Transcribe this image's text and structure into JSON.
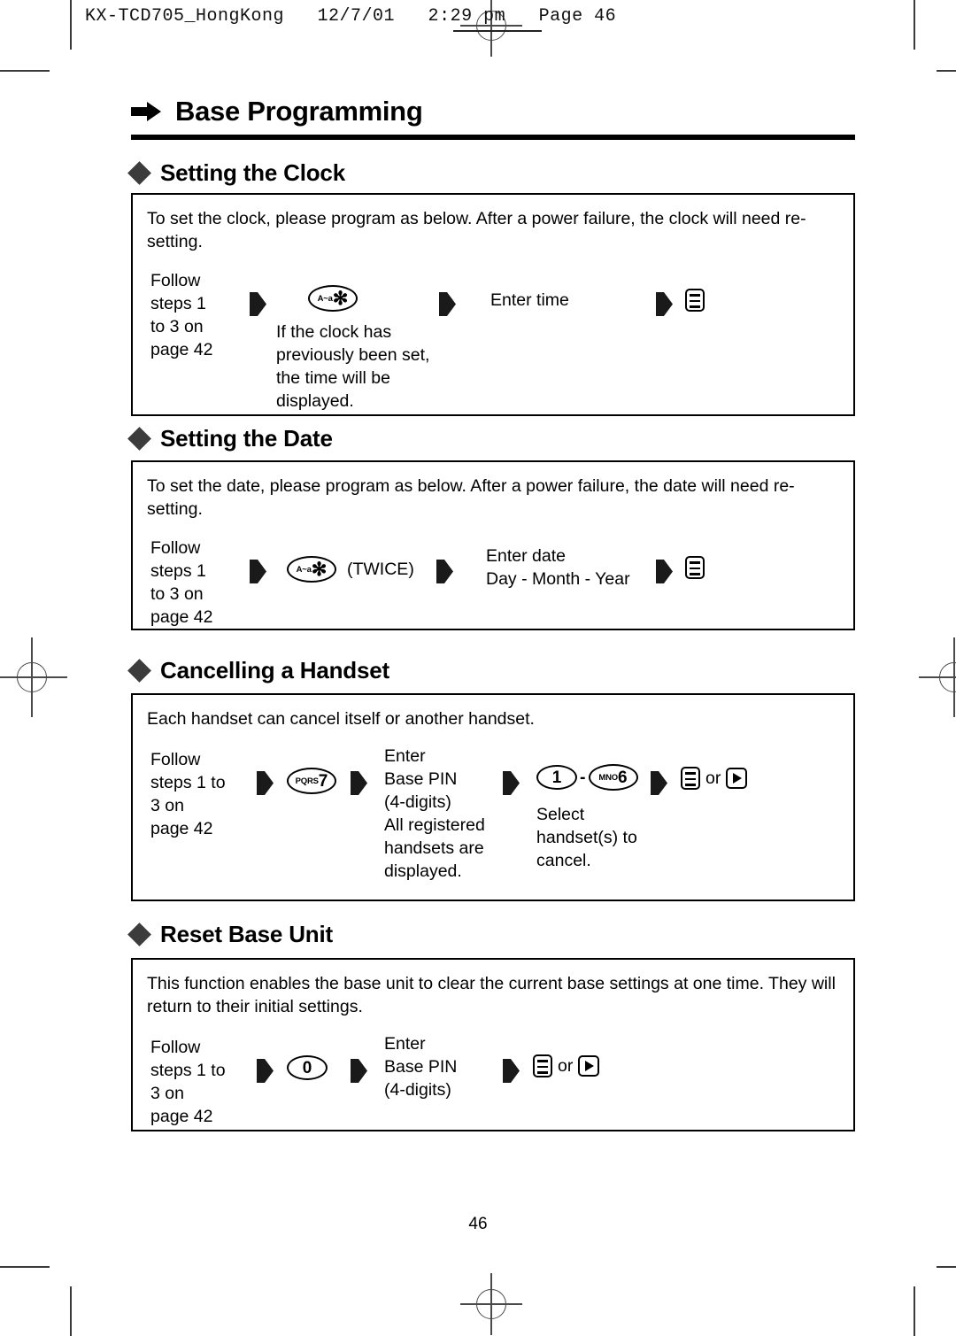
{
  "print_header": {
    "text": "KX-TCD705_HongKong   12/7/01   2:29 pm   Page 46"
  },
  "chapter": {
    "icon": "right-arrow-icon",
    "title": "Base Programming"
  },
  "sections": [
    {
      "id": "setting-the-clock",
      "bullet": "diamond-bullet-icon",
      "title": "Setting the Clock",
      "intro": "To set the clock, please program as below. After a power failure, the clock will need re-setting.",
      "steps": [
        {
          "label": "Follow\nsteps 1\nto 3 on\npage 42"
        },
        {
          "key_prefix": "A~a",
          "key_glyph": "✻",
          "note": "If the clock has\npreviously been set,\nthe time will be\ndisplayed."
        },
        {
          "label": "Enter time"
        },
        {
          "icon": "menu-display-icon"
        }
      ]
    },
    {
      "id": "setting-the-date",
      "bullet": "diamond-bullet-icon",
      "title": "Setting the Date",
      "intro": "To set the date, please program as below. After a power failure, the date will need re-setting.",
      "steps": [
        {
          "label": "Follow\nsteps 1\nto 3 on\npage 42"
        },
        {
          "key_prefix": "A~a",
          "key_glyph": "✻",
          "suffix": "(TWICE)"
        },
        {
          "label": "Enter date\nDay - Month - Year"
        },
        {
          "icon": "menu-display-icon"
        }
      ]
    },
    {
      "id": "cancelling-a-handset",
      "bullet": "diamond-bullet-icon",
      "title": "Cancelling a Handset",
      "intro": "Each handset can cancel itself or another handset.",
      "steps": [
        {
          "label": "Follow\nsteps 1 to\n3 on\npage 42"
        },
        {
          "key_prefix": "PQRS",
          "key_glyph": "7"
        },
        {
          "label": "Enter\nBase PIN\n(4-digits)",
          "note": "All registered\nhandsets are\ndisplayed."
        },
        {
          "key_from_prefix": "",
          "key_from_glyph": "1",
          "range_dash": "-",
          "key_to_prefix": "MNO",
          "key_to_glyph": "6",
          "note": "Select\nhandset(s) to\ncancel."
        },
        {
          "icon": "menu-display-icon",
          "or_label": "or",
          "icon2": "play-right-icon"
        }
      ]
    },
    {
      "id": "reset-base-unit",
      "bullet": "diamond-bullet-icon",
      "title": "Reset Base Unit",
      "intro": "This function enables the base unit to clear the current base settings at one time. They will return to their initial settings.",
      "steps": [
        {
          "label": "Follow\nsteps 1 to\n3 on\npage 42"
        },
        {
          "key_prefix": "",
          "key_glyph": "0"
        },
        {
          "label": "Enter\nBase PIN\n(4-digits)"
        },
        {
          "icon": "menu-display-icon",
          "or_label": "or",
          "icon2": "play-right-icon"
        }
      ]
    }
  ],
  "footer": {
    "page_number": "46"
  },
  "colors": {
    "ink": "#000000",
    "bullet": "#3c3c3c",
    "crop_mark": "#4a4a4a",
    "paper": "#ffffff"
  }
}
